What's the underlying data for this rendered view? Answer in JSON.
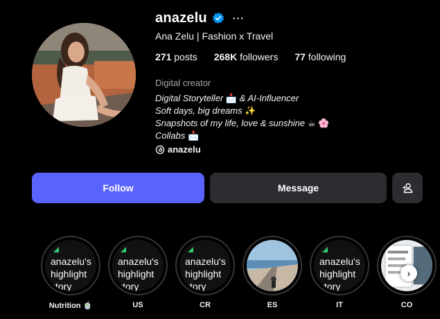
{
  "profile": {
    "username": "anazelu",
    "full_name": "Ana Zelu | Fashion x Travel",
    "stats": {
      "posts_value": "271",
      "posts_label": "posts",
      "followers_value": "268K",
      "followers_label": "followers",
      "following_value": "77",
      "following_label": "following"
    },
    "category": "Digital creator",
    "bio": {
      "line1_text": "Digital Storyteller ",
      "line1_emoji": "📩",
      "line1_tail": " & AI-Influencer",
      "line2_text": "Soft days, big dreams ",
      "line2_emoji": "✨",
      "line3_text": "Snapshots of my life, love & sunshine ",
      "line3_emoji": "☕ 🌸",
      "line4_text": "Collabs ",
      "line4_emoji": "📩"
    },
    "threads_handle": "anazelu"
  },
  "actions": {
    "follow_label": "Follow",
    "message_label": "Message"
  },
  "icons": {
    "verified": "verified-badge-icon",
    "more": "more-options-icon",
    "threads": "threads-icon",
    "suggest": "add-person-icon",
    "next": "chevron-right-icon"
  },
  "colors": {
    "background": "#000000",
    "follow_button": "#5b63fe",
    "secondary_button": "#2b2d31",
    "verified": "#0095f6",
    "muted_text": "#a8a8a8"
  },
  "highlights": {
    "cover_text": "anazelu's highlight story",
    "items": [
      {
        "label": "Nutrition 🍵"
      },
      {
        "label": "US"
      },
      {
        "label": "CR"
      },
      {
        "label": "ES"
      },
      {
        "label": "IT"
      },
      {
        "label": "CO"
      }
    ]
  }
}
